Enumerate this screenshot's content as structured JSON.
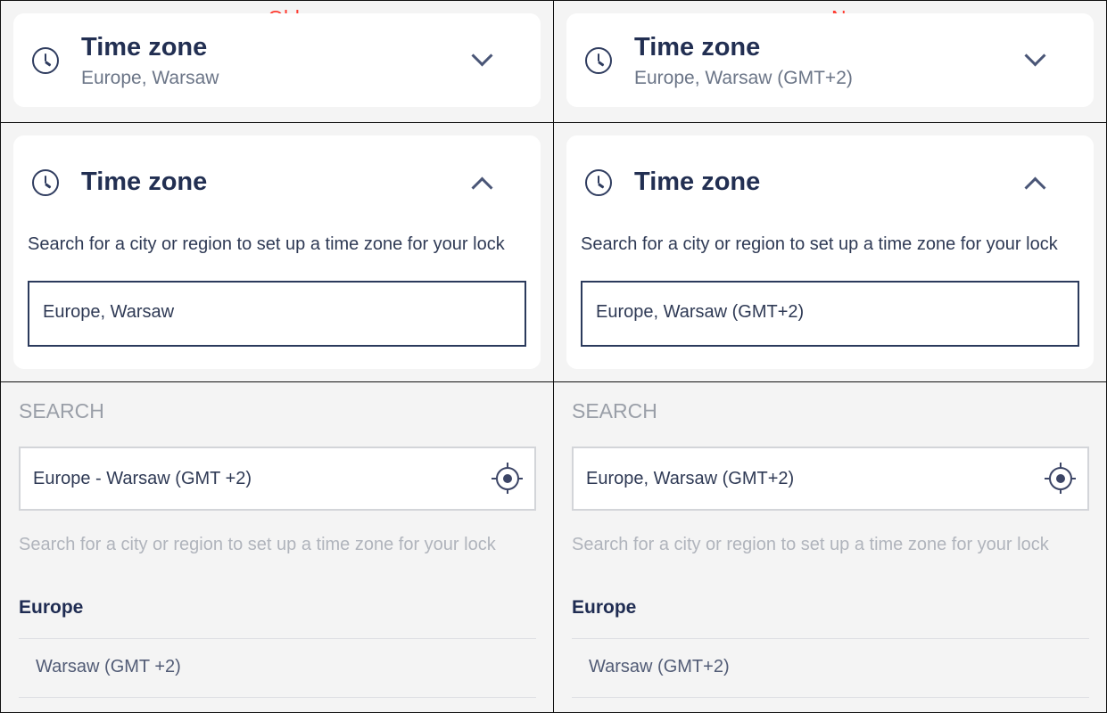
{
  "columns": [
    {
      "label": "Old",
      "collapsed": {
        "title": "Time zone",
        "value": "Europe, Warsaw"
      },
      "expanded": {
        "title": "Time zone",
        "description": "Search for a city or region to set up a time zone for your lock",
        "field_value": "Europe, Warsaw"
      },
      "search": {
        "heading": "SEARCH",
        "input_value": "Europe - Warsaw (GMT +2)",
        "hint": "Search for a city or region to set up a time zone for your lock",
        "group": "Europe",
        "result": "Warsaw (GMT +2)"
      }
    },
    {
      "label": "New",
      "collapsed": {
        "title": "Time zone",
        "value": "Europe, Warsaw (GMT+2)"
      },
      "expanded": {
        "title": "Time zone",
        "description": "Search for a city or region to set up a time zone for your lock",
        "field_value": "Europe, Warsaw (GMT+2)"
      },
      "search": {
        "heading": "SEARCH",
        "input_value": "Europe, Warsaw (GMT+2)",
        "hint": "Search for a city or region to set up a time zone for your lock",
        "group": "Europe",
        "result": "Warsaw (GMT+2)"
      }
    }
  ],
  "colors": {
    "label": "#ff3b30",
    "title": "#222f52",
    "background": "#f4f4f4",
    "card": "#ffffff"
  }
}
